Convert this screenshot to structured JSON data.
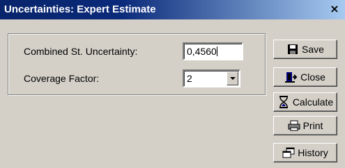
{
  "window": {
    "title": "Uncertainties: Expert Estimate",
    "close_glyph": "×"
  },
  "form": {
    "combined_label": "Combined St. Uncertainty:",
    "combined_value": "0,4560",
    "coverage_label": "Coverage Factor:",
    "coverage_value": "2"
  },
  "buttons": {
    "save": "Save",
    "close": "Close",
    "calculate": "Calculate",
    "print": "Print",
    "history": "History"
  },
  "icons": {
    "save": "floppy-disk-icon",
    "close": "door-exit-icon",
    "calculate": "hourglass-icon",
    "print": "printer-icon",
    "history": "windows-copy-icon"
  },
  "colors": {
    "title_bar_start": "#08246b",
    "title_bar_end": "#a6caf0",
    "face": "#d4d0c8"
  }
}
